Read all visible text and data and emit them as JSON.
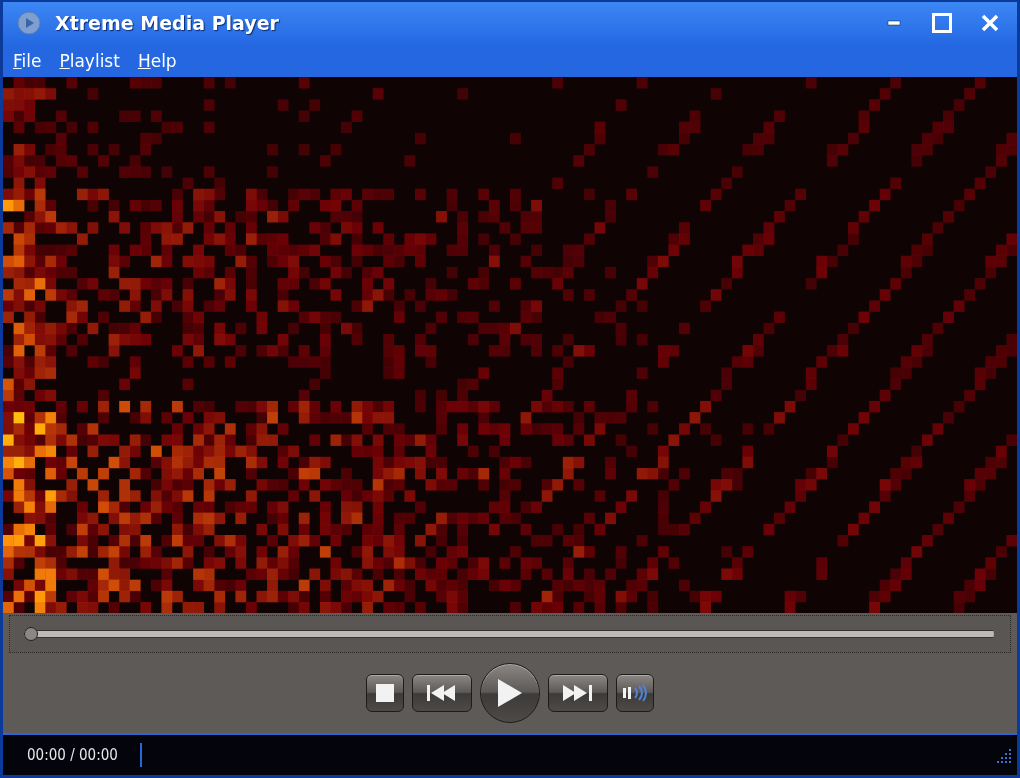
{
  "window": {
    "title": "Xtreme Media Player"
  },
  "menu": [
    {
      "label": "File"
    },
    {
      "label": "Playlist"
    },
    {
      "label": "Help"
    }
  ],
  "seek": {
    "level": 0
  },
  "controls": [
    {
      "kind": "stop"
    },
    {
      "kind": "previous"
    },
    {
      "kind": "play"
    },
    {
      "kind": "next"
    },
    {
      "kind": "volume"
    }
  ],
  "status_bar": {
    "time": "00:00 / 00:00"
  }
}
